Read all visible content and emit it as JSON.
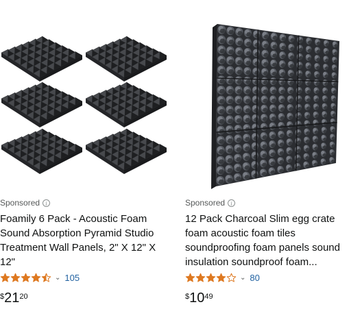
{
  "products": [
    {
      "sponsored": "Sponsored",
      "title": "Foamily 6 Pack - Acoustic Foam Sound Absorption Pyramid Studio Treatment Wall Panels, 2\" X 12\" X 12\"",
      "rating": 4.5,
      "review_count": "105",
      "price_symbol": "$",
      "price_whole": "21",
      "price_fraction": "20",
      "image": "pyramid-foam-panels-image"
    },
    {
      "sponsored": "Sponsored",
      "title": "12 Pack Charcoal Slim egg crate foam acoustic foam tiles soundproofing foam panels sound insulation soundproof foam...",
      "rating": 4.0,
      "review_count": "80",
      "price_symbol": "$",
      "price_whole": "10",
      "price_fraction": "49",
      "image": "egg-crate-foam-panels-image"
    }
  ],
  "colors": {
    "link": "#2162a1",
    "star": "#de7921",
    "muted": "#565959",
    "foam": "#2f3033"
  }
}
